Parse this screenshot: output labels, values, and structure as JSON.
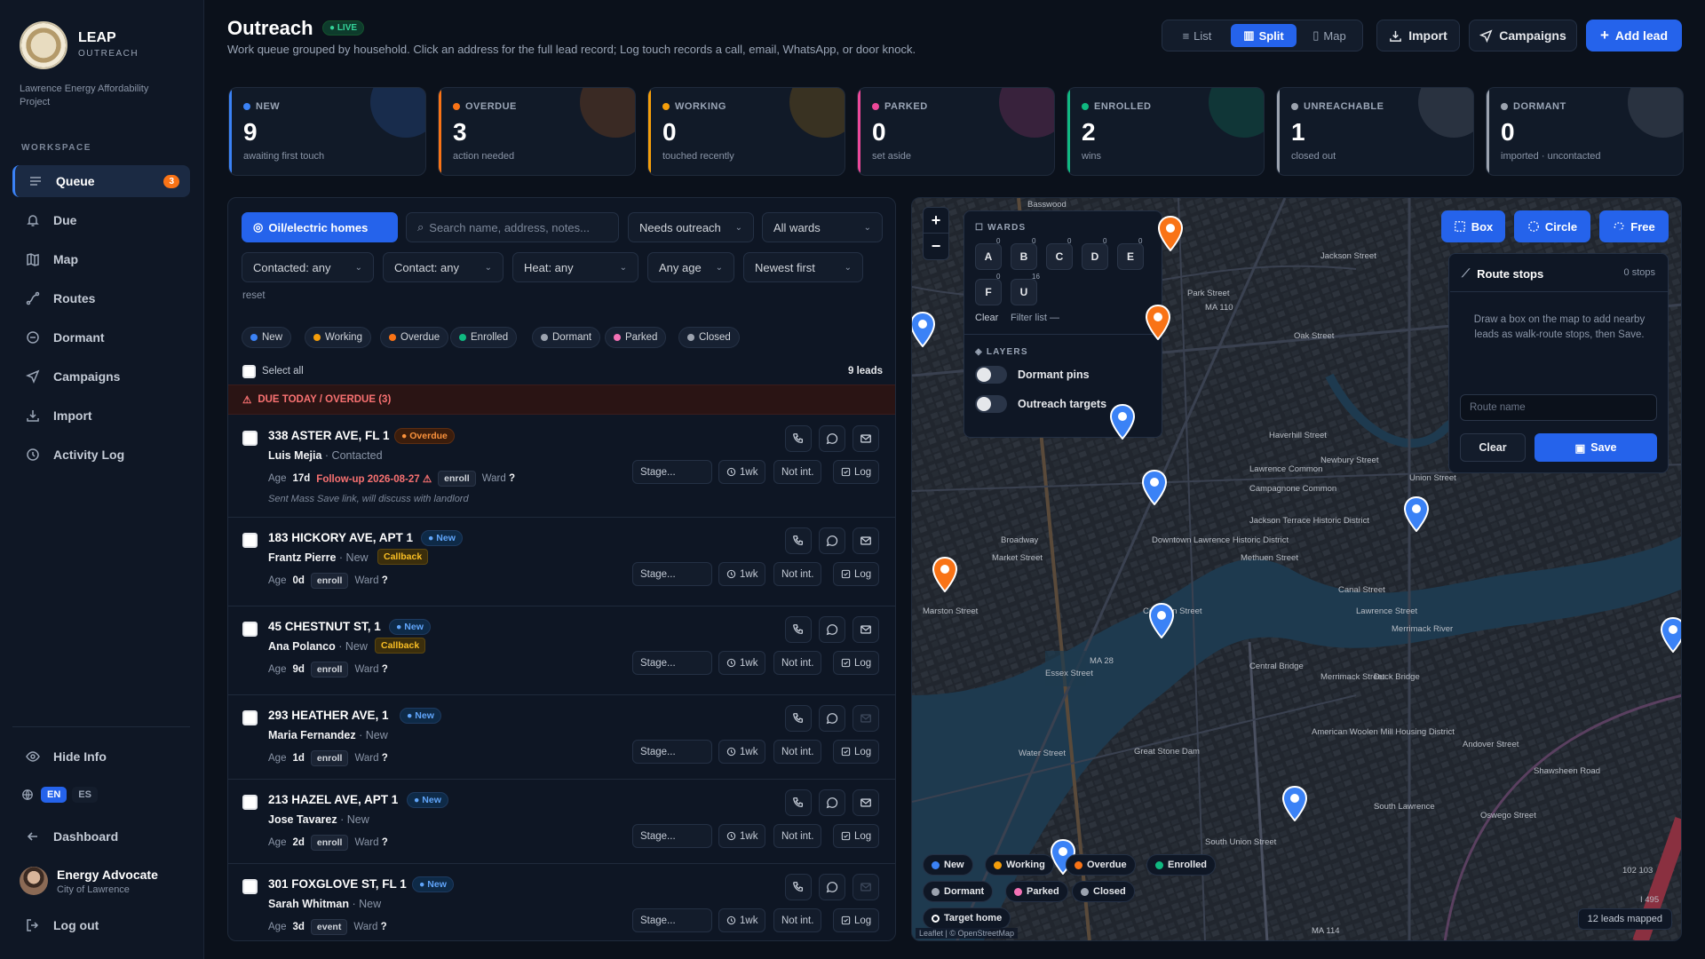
{
  "sidebar": {
    "brand": "LEAP",
    "brand_sub": "OUTREACH",
    "org": "Lawrence Energy Affordability Project",
    "section": "WORKSPACE",
    "items": [
      {
        "label": "Queue",
        "badge": "3"
      },
      {
        "label": "Due"
      },
      {
        "label": "Map"
      },
      {
        "label": "Routes"
      },
      {
        "label": "Dormant"
      },
      {
        "label": "Campaigns"
      },
      {
        "label": "Import"
      },
      {
        "label": "Activity Log"
      }
    ],
    "hide_info": "Hide Info",
    "lang_en": "EN",
    "lang_es": "ES",
    "dashboard": "Dashboard",
    "user_name": "Energy Advocate",
    "user_org": "City of Lawrence",
    "logout": "Log out"
  },
  "header": {
    "title": "Outreach",
    "live": "LIVE",
    "subtitle": "Work queue grouped by household. Click an address for the full lead record; Log touch records a call, email, WhatsApp, or door knock.",
    "views": [
      "List",
      "Split",
      "Map"
    ],
    "active_view": "Split",
    "import": "Import",
    "campaigns": "Campaigns",
    "add_lead": "Add lead"
  },
  "stats": [
    {
      "label": "NEW",
      "value": "9",
      "sub": "awaiting first touch",
      "color": "#3b82f6"
    },
    {
      "label": "OVERDUE",
      "value": "3",
      "sub": "action needed",
      "color": "#f97316"
    },
    {
      "label": "WORKING",
      "value": "0",
      "sub": "touched recently",
      "color": "#f59e0b"
    },
    {
      "label": "PARKED",
      "value": "0",
      "sub": "set aside",
      "color": "#ec4899"
    },
    {
      "label": "ENROLLED",
      "value": "2",
      "sub": "wins",
      "color": "#10b981"
    },
    {
      "label": "UNREACHABLE",
      "value": "1",
      "sub": "closed out",
      "color": "#9ca3af"
    },
    {
      "label": "DORMANT",
      "value": "0",
      "sub": "imported · uncontacted",
      "color": "#9ca3af"
    }
  ],
  "filters": {
    "oil_toggle": "Oil/electric homes",
    "search_placeholder": "Search name, address, notes...",
    "needs": "Needs outreach",
    "wards": "All wards",
    "contacted": "Contacted: any",
    "contact": "Contact: any",
    "heat": "Heat: any",
    "age": "Any age",
    "sort": "Newest first",
    "reset": "reset"
  },
  "chips": [
    {
      "label": "New",
      "color": "#3b82f6"
    },
    {
      "label": "Working",
      "color": "#f59e0b"
    },
    {
      "label": "Overdue",
      "color": "#f97316"
    },
    {
      "label": "Enrolled",
      "color": "#10b981"
    },
    {
      "label": "Dormant",
      "color": "#9ca3af"
    },
    {
      "label": "Parked",
      "color": "#f472b6"
    },
    {
      "label": "Closed",
      "color": "#9ca3af"
    }
  ],
  "list": {
    "select_all": "Select all",
    "count": "9 leads",
    "due_header": "DUE TODAY / OVERDUE (3)"
  },
  "leads": [
    {
      "address": "338 ASTER AVE, FL 1",
      "status": "Overdue",
      "name": "Luis Mejia",
      "contact_state": "· Contacted",
      "age_prefix": "Age",
      "age": "17d",
      "follow_up": "Follow-up 2026-08-27",
      "tag": "enroll",
      "ward_label": "Ward",
      "ward": "?",
      "note": "Sent Mass Save link, will discuss with landlord",
      "stage": "Stage...",
      "snooze": "1wk",
      "not_int": "Not int.",
      "log": "Log"
    },
    {
      "address": "183 HICKORY AVE, APT 1",
      "status": "New",
      "name": "Frantz Pierre",
      "contact_state": "· New",
      "callback": "Callback",
      "age_prefix": "Age",
      "age": "0d",
      "tag": "enroll",
      "ward_label": "Ward",
      "ward": "?",
      "stage": "Stage...",
      "snooze": "1wk",
      "not_int": "Not int.",
      "log": "Log"
    },
    {
      "address": "45 CHESTNUT ST, 1",
      "status": "New",
      "name": "Ana Polanco",
      "contact_state": "· New",
      "callback": "Callback",
      "age_prefix": "Age",
      "age": "9d",
      "tag": "enroll",
      "ward_label": "Ward",
      "ward": "?",
      "stage": "Stage...",
      "snooze": "1wk",
      "not_int": "Not int.",
      "log": "Log"
    },
    {
      "address": "293 HEATHER AVE, 1",
      "status": "New",
      "name": "Maria Fernandez",
      "contact_state": "· New",
      "age_prefix": "Age",
      "age": "1d",
      "tag": "enroll",
      "ward_label": "Ward",
      "ward": "?",
      "stage": "Stage...",
      "snooze": "1wk",
      "not_int": "Not int.",
      "log": "Log"
    },
    {
      "address": "213 HAZEL AVE, APT 1",
      "status": "New",
      "name": "Jose Tavarez",
      "contact_state": "· New",
      "age_prefix": "Age",
      "age": "2d",
      "tag": "enroll",
      "ward_label": "Ward",
      "ward": "?",
      "stage": "Stage...",
      "snooze": "1wk",
      "not_int": "Not int.",
      "log": "Log"
    },
    {
      "address": "301 FOXGLOVE ST, FL 1",
      "status": "New",
      "name": "Sarah Whitman",
      "contact_state": "· New",
      "age_prefix": "Age",
      "age": "3d",
      "tag": "event",
      "ward_label": "Ward",
      "ward": "?",
      "stage": "Stage...",
      "snooze": "1wk",
      "not_int": "Not int.",
      "log": "Log"
    }
  ],
  "map": {
    "wards_title": "WARDS",
    "wards": [
      {
        "label": "A",
        "count": "0"
      },
      {
        "label": "B",
        "count": "0"
      },
      {
        "label": "C",
        "count": "0"
      },
      {
        "label": "D",
        "count": "0"
      },
      {
        "label": "E",
        "count": "0"
      },
      {
        "label": "F",
        "count": "0"
      },
      {
        "label": "U",
        "count": "16"
      }
    ],
    "clear": "Clear",
    "filter_list": "Filter list —",
    "layers_title": "LAYERS",
    "layer_dormant": "Dormant pins",
    "layer_targets": "Outreach targets",
    "draw_box": "Box",
    "draw_circle": "Circle",
    "draw_free": "Free",
    "route_title": "Route stops",
    "route_count": "0 stops",
    "route_help": "Draw a box on the map to add nearby leads as walk-route stops, then Save.",
    "route_placeholder": "Route name",
    "route_clear": "Clear",
    "route_save": "Save",
    "legend": [
      {
        "label": "New",
        "color": "#3b82f6"
      },
      {
        "label": "Working",
        "color": "#f59e0b"
      },
      {
        "label": "Overdue",
        "color": "#f97316"
      },
      {
        "label": "Enrolled",
        "color": "#10b981"
      },
      {
        "label": "Dormant",
        "color": "#9ca3af"
      },
      {
        "label": "Parked",
        "color": "#f472b6"
      },
      {
        "label": "Closed",
        "color": "#9ca3af"
      },
      {
        "label": "Target home",
        "color": "#ffffff"
      }
    ],
    "mapped": "12 leads mapped",
    "attribution": "Leaflet | © OpenStreetMap",
    "labels": [
      "Basswood",
      "Park Street",
      "MA 110",
      "Oak Street",
      "Haverhill Street",
      "Lawrence Common",
      "Campagnone Common",
      "Jackson Terrace Historic District",
      "Downtown Lawrence Historic District",
      "Methuen Street",
      "Canal Street",
      "Central Bridge",
      "Duck Bridge",
      "MA 28",
      "Merrimack Street",
      "Merrimack River",
      "American Woolen Mill Housing District",
      "Great Stone Dam",
      "South Lawrence",
      "Andover Street",
      "MA 114",
      "Broadway",
      "Essex Street",
      "Common Street",
      "Union Street",
      "Jackson Street",
      "Lawrence Street",
      "Newbury Street",
      "Market Street",
      "South Union Street",
      "Shawsheen Road",
      "I 495",
      "102 103",
      "Oswego Street",
      "Water Street",
      "Marston Street"
    ]
  }
}
